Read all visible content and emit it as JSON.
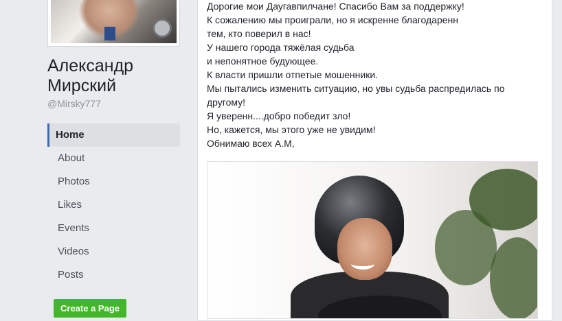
{
  "profile": {
    "name": "Александр Мирский",
    "handle": "@Mirsky777"
  },
  "nav": {
    "items": [
      {
        "label": "Home",
        "active": true
      },
      {
        "label": "About"
      },
      {
        "label": "Photos"
      },
      {
        "label": "Likes"
      },
      {
        "label": "Events"
      },
      {
        "label": "Videos"
      },
      {
        "label": "Posts"
      }
    ]
  },
  "create_page_label": "Create a Page",
  "post": {
    "lines": [
      "Дорогие мои Даугавпилчане! Спасибо Вам за поддержку!",
      "К сожалению мы проиграли, но я искренне благодаренн",
      "тем, кто поверил в нас!",
      "У нашего города тяжёлая судьба",
      "и непонятное будующее.",
      "К власти пришли отпетые мошенники.",
      "Мы пытались изменить ситуацию, но увы судьба распредилась по",
      "другому!",
      "Я уверенн....добро победит зло!",
      "Но, кажется, мы этого уже не увидим!",
      "Обнимаю всех А.М,"
    ]
  },
  "colors": {
    "accent": "#4267b2",
    "create_button": "#42b72a",
    "page_bg": "#e9ebee"
  }
}
